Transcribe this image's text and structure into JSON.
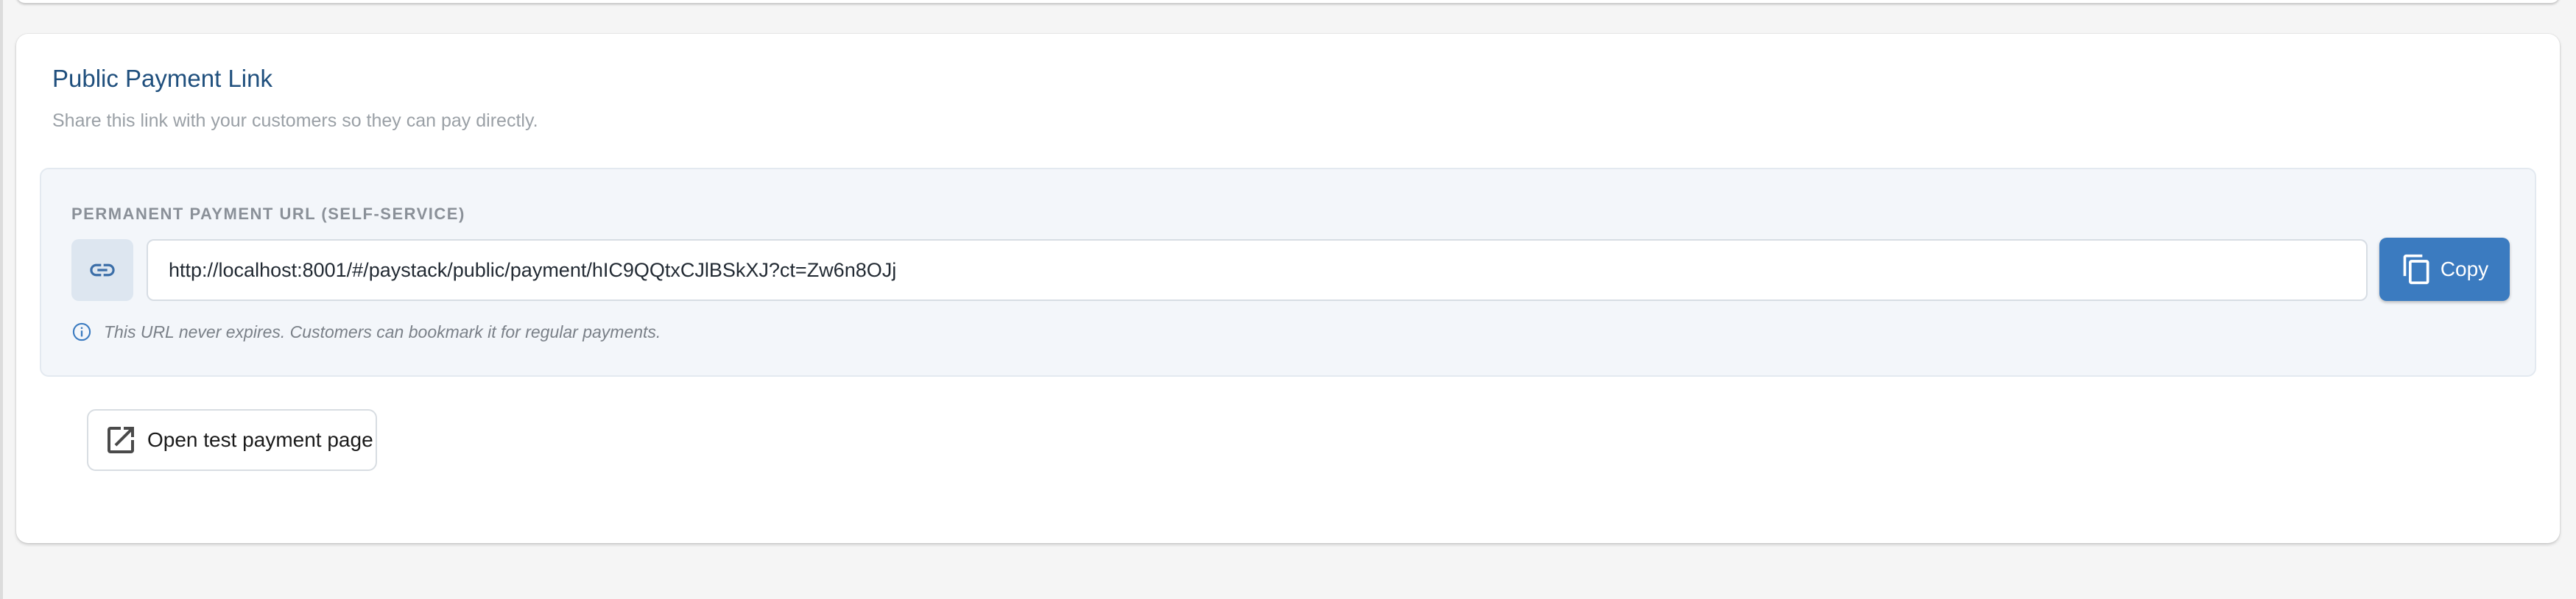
{
  "card": {
    "title": "Public Payment Link",
    "subtitle": "Share this link with your customers so they can pay directly."
  },
  "url_panel": {
    "label": "PERMANENT PAYMENT URL (SELF-SERVICE)",
    "url_value": "http://localhost:8001/#/paystack/public/payment/hIC9QQtxCJlBSkXJ?ct=Zw6n8OJj",
    "copy_label": "Copy",
    "hint": "This URL never expires. Customers can bookmark it for regular payments.",
    "link_icon": "link-icon",
    "copy_icon": "copy-icon",
    "info_icon": "info-icon"
  },
  "actions": {
    "open_test_label": "Open test payment page",
    "open_test_icon": "open-in-new-icon"
  },
  "colors": {
    "title": "#1f4f7d",
    "accent": "#3b7bc0",
    "panel_bg": "#f3f6fa"
  }
}
